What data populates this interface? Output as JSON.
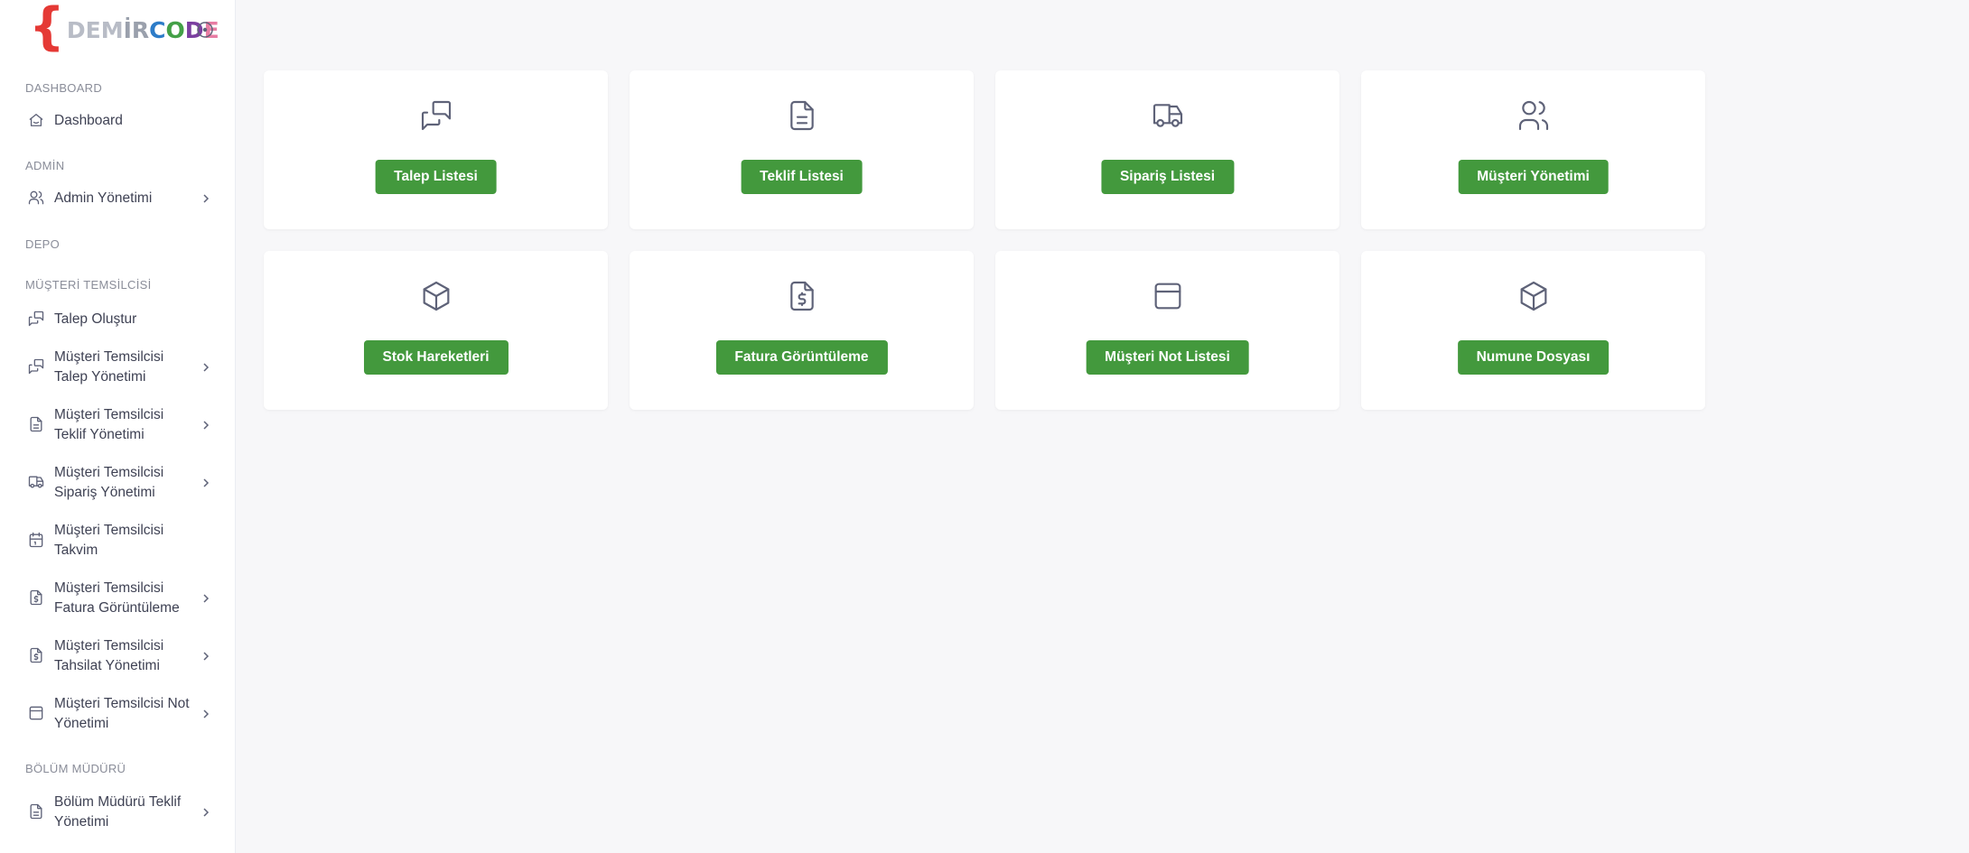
{
  "brand": {
    "brace": "{",
    "parts": [
      "DEM",
      "İ",
      "R",
      "C",
      "O",
      "D",
      "E"
    ]
  },
  "sidebar": {
    "sections": {
      "dashboard": "DASHBOARD",
      "admin": "ADMİN",
      "depo": "DEPO",
      "musteri": "MÜŞTERİ TEMSİLCİSİ",
      "bolum": "BÖLÜM MÜDÜRÜ"
    },
    "items": [
      {
        "label": "Dashboard",
        "icon": "home-icon"
      },
      {
        "label": "Admin Yönetimi",
        "icon": "users-icon"
      },
      {
        "label": "Talep Oluştur",
        "icon": "messages-icon"
      },
      {
        "label": "Müşteri Temsilcisi Talep Yönetimi",
        "icon": "messages-icon"
      },
      {
        "label": "Müşteri Temsilcisi Teklif Yönetimi",
        "icon": "document-icon"
      },
      {
        "label": "Müşteri Temsilcisi Sipariş Yönetimi",
        "icon": "truck-icon"
      },
      {
        "label": "Müşteri Temsilcisi Takvim",
        "icon": "calendar-icon"
      },
      {
        "label": "Müşteri Temsilcisi Fatura Görüntüleme",
        "icon": "invoice-icon"
      },
      {
        "label": "Müşteri Temsilcisi Tahsilat Yönetimi",
        "icon": "invoice-icon"
      },
      {
        "label": "Müşteri Temsilcisi Not Yönetimi",
        "icon": "window-icon"
      },
      {
        "label": "Bölüm Müdürü Teklif Yönetimi",
        "icon": "document-icon"
      }
    ]
  },
  "cards": [
    {
      "label": "Talep Listesi",
      "icon": "messages-icon"
    },
    {
      "label": "Teklif Listesi",
      "icon": "document-icon"
    },
    {
      "label": "Sipariş Listesi",
      "icon": "truck-icon"
    },
    {
      "label": "Müşteri Yönetimi",
      "icon": "users-icon"
    },
    {
      "label": "Stok Hareketleri",
      "icon": "box-icon"
    },
    {
      "label": "Fatura Görüntüleme",
      "icon": "invoice-icon"
    },
    {
      "label": "Müşteri Not Listesi",
      "icon": "window-icon"
    },
    {
      "label": "Numune Dosyası",
      "icon": "box-icon"
    }
  ],
  "colors": {
    "accent": "#43993d",
    "brand_red": "#e53935",
    "background": "#f7f7f9",
    "icon": "#5e6278"
  }
}
